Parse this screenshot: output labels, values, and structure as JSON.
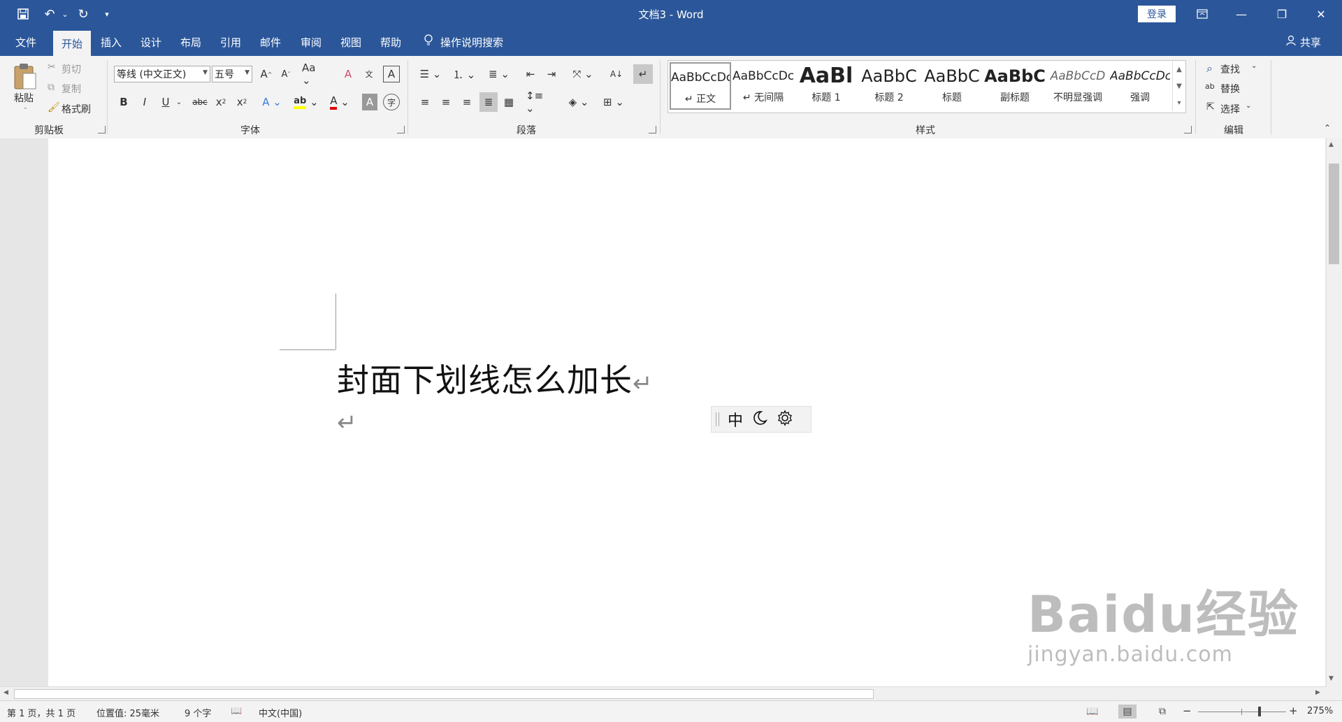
{
  "window": {
    "title": "文档3 - Word",
    "login_label": "登录"
  },
  "tabs": [
    "文件",
    "开始",
    "插入",
    "设计",
    "布局",
    "引用",
    "邮件",
    "审阅",
    "视图",
    "帮助"
  ],
  "active_tab": "开始",
  "tell_me": "操作说明搜索",
  "share": "共享",
  "ribbon": {
    "clipboard": {
      "paste": "粘贴",
      "cut": "剪切",
      "copy": "复制",
      "format_painter": "格式刷",
      "group_label": "剪贴板"
    },
    "font": {
      "font_name": "等线 (中文正文)",
      "font_size": "五号",
      "group_label": "字体"
    },
    "paragraph": {
      "group_label": "段落"
    },
    "styles": {
      "group_label": "样式",
      "items": [
        {
          "sample": "AaBbCcDc",
          "name": "↵ 正文"
        },
        {
          "sample": "AaBbCcDc",
          "name": "↵ 无间隔"
        },
        {
          "sample": "AaBl",
          "name": "标题 1"
        },
        {
          "sample": "AaBbC",
          "name": "标题 2"
        },
        {
          "sample": "AaBbC",
          "name": "标题"
        },
        {
          "sample": "AaBbC",
          "name": "副标题"
        },
        {
          "sample": "AaBbCcD",
          "name": "不明显强调"
        },
        {
          "sample": "AaBbCcDc",
          "name": "强调"
        }
      ]
    },
    "editing": {
      "find": "查找",
      "replace": "替换",
      "select": "选择",
      "group_label": "编辑"
    }
  },
  "document": {
    "title_text": "封面下划线怎么加长",
    "paragraph_mark": "↵"
  },
  "ime": {
    "mode": "中"
  },
  "watermark": {
    "main": "Baidu经验",
    "url": "jingyan.baidu.com"
  },
  "statusbar": {
    "page": "第 1 页，共 1 页",
    "position": "位置值: 25毫米",
    "words": "9 个字",
    "language": "中文(中国)",
    "zoom": "275%"
  },
  "colors": {
    "title_bar": "#2b579a",
    "ribbon_bg": "#f3f3f3",
    "font_color": "#e00000",
    "highlight": "#ffff00"
  }
}
